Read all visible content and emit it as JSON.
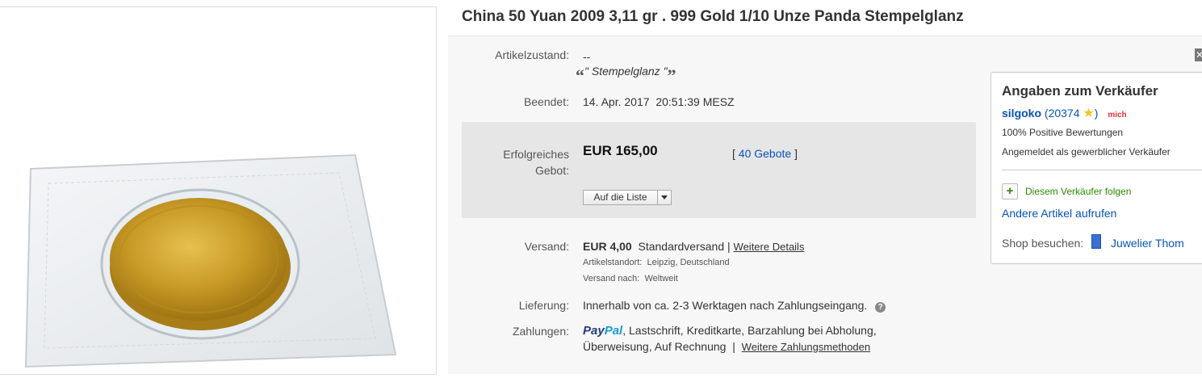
{
  "item": {
    "title": "China 50 Yuan 2009 3,11 gr . 999 Gold 1/10 Unze Panda Stempelglanz"
  },
  "condition": {
    "label": "Artikelzustand:",
    "value": "--",
    "quote_open": "“",
    "note": "\" Stempelglanz \"",
    "quote_close": "”"
  },
  "ended": {
    "label": "Beendet:",
    "date": "14. Apr. 2017",
    "time": "20:51:39 MESZ"
  },
  "bid": {
    "label_line1": "Erfolgreiches",
    "label_line2": "Gebot:",
    "price": "EUR 165,00",
    "bids_bracket_open": "[",
    "bids_link": "40 Gebote",
    "bids_bracket_close": "]",
    "watch_label": "Auf die Liste"
  },
  "shipping": {
    "label": "Versand:",
    "price": "EUR 4,00",
    "method": "Standardversand",
    "separator": "|",
    "details_link": "Weitere Details",
    "location_label": "Artikelstandort:",
    "location": "Leipzig, Deutschland",
    "ships_to_label": "Versand nach:",
    "ships_to": "Weltweit"
  },
  "delivery": {
    "label": "Lieferung:",
    "text": "Innerhalb von ca. 2-3 Werktagen nach Zahlungseingang.",
    "help": "?"
  },
  "payments": {
    "label": "Zahlungen:",
    "paypal_1": "Pay",
    "paypal_2": "Pal",
    "line1_rest": ",  Lastschrift,  Kreditkarte,  Barzahlung bei Abholung,",
    "line2": "Überweisung,  Auf Rechnung",
    "separator": "|",
    "more_link": "Weitere Zahlungsmethoden"
  },
  "seller": {
    "heading": "Angaben zum Verkäufer",
    "name": "silgoko",
    "feedback_open": "(",
    "feedback_score": "20374",
    "feedback_close": ")",
    "me_badge": "mich",
    "positive": "100% Positive Bewertungen",
    "registered": "Angemeldet als gewerblicher Verkäufer",
    "follow": "Diesem Verkäufer folgen",
    "other_items": "Andere Artikel aufrufen",
    "shop_label": "Shop besuchen:",
    "shop_name": "Juwelier Thom"
  },
  "colors": {
    "link": "#0654ba",
    "follow_green": "#2b8a00",
    "gold": "#c9a227"
  }
}
